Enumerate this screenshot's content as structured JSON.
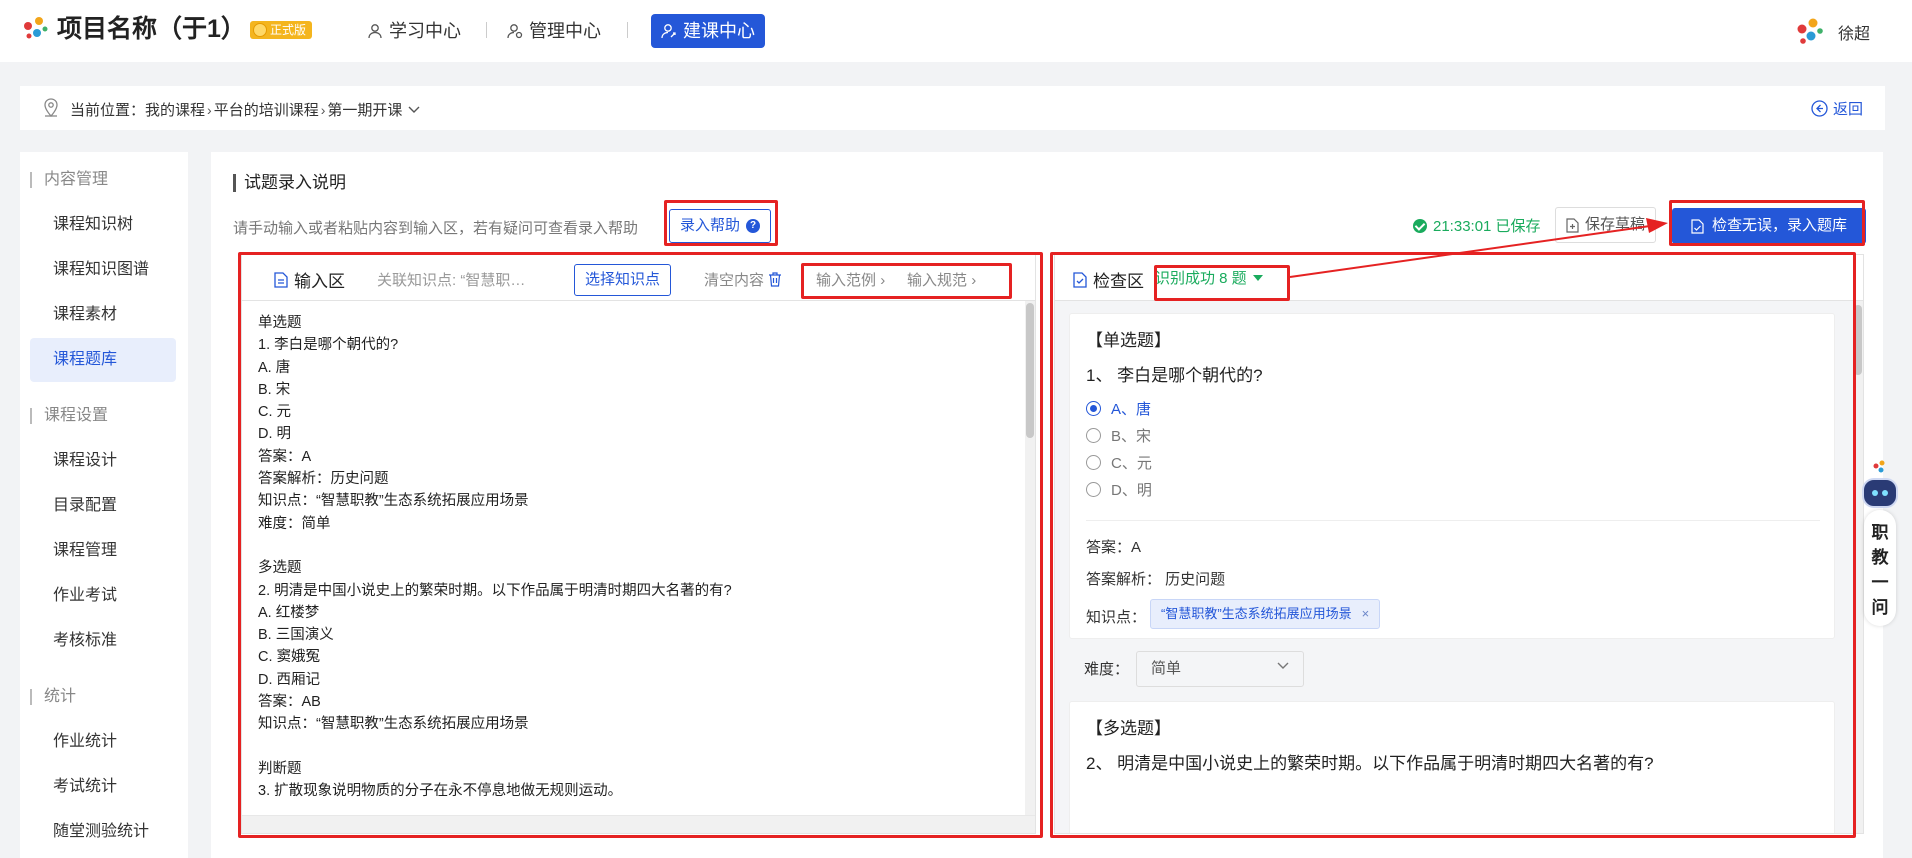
{
  "header": {
    "app_title": "项目名称（于1）",
    "edition": "正式版",
    "nav": [
      {
        "label": "学习中心",
        "icon": "user-study-icon"
      },
      {
        "label": "管理中心",
        "icon": "user-manage-icon"
      },
      {
        "label": "建课中心",
        "icon": "user-build-icon",
        "active": true
      }
    ],
    "user_name": "徐超"
  },
  "breadcrumb": {
    "prefix": "当前位置：",
    "items": [
      "我的课程",
      "平台的培训课程",
      "第一期开课"
    ],
    "back_label": "返回"
  },
  "sidebar": {
    "groups": [
      {
        "title": "内容管理",
        "items": [
          "课程知识树",
          "课程知识图谱",
          "课程素材",
          "课程题库"
        ]
      },
      {
        "title": "课程设置",
        "items": [
          "课程设计",
          "目录配置",
          "课程管理",
          "作业考试",
          "考核标准"
        ]
      },
      {
        "title": "统计",
        "items": [
          "作业统计",
          "考试统计",
          "随堂测验统计"
        ]
      }
    ],
    "active_item": "课程题库"
  },
  "main": {
    "section_title": "试题录入说明",
    "hint": "请手动输入或者粘贴内容到输入区，若有疑问可查看录入帮助",
    "help_label": "录入帮助",
    "saved_status": "21:33:01 已保存",
    "draft_label": "保存草稿",
    "submit_label": "检查无误，录入题库",
    "input_panel": {
      "title": "输入区",
      "knowledge_relation": "关联知识点: “智慧职…",
      "select_kp_label": "选择知识点",
      "clear_label": "清空内容",
      "example_label": "输入范例",
      "spec_label": "输入规范",
      "lines": [
        "单选题",
        "1. 李白是哪个朝代的?",
        "A. 唐",
        "B. 宋",
        "C. 元",
        "D. 明",
        "答案：A",
        "答案解析：历史问题",
        "知识点：“智慧职教”生态系统拓展应用场景",
        "难度：简单",
        "",
        "多选题",
        "2. 明清是中国小说史上的繁荣时期。以下作品属于明清时期四大名著的有?",
        "A. 红楼梦",
        "B. 三国演义",
        "C. 窦娥冤",
        "D. 西厢记",
        "答案：AB",
        "知识点：“智慧职教”生态系统拓展应用场景",
        "",
        "判断题",
        "3. 扩散现象说明物质的分子在永不停息地做无规则运动。"
      ]
    },
    "check_panel": {
      "title": "检查区",
      "recognized": "识别成功 8 题",
      "questions": [
        {
          "type": "【单选题】",
          "stem": "1、 李白是哪个朝代的?",
          "options": [
            "A、唐",
            "B、宋",
            "C、元",
            "D、明"
          ],
          "selected": "A、唐",
          "answer": "答案：A",
          "analysis": "答案解析：  历史问题",
          "kp_label": "知识点：",
          "kp_tag": "“智慧职教”生态系统拓展应用场景",
          "difficulty_label": "难度：",
          "difficulty": "简单"
        },
        {
          "type": "【多选题】",
          "stem": "2、 明清是中国小说史上的繁荣时期。以下作品属于明清时期四大名著的有?"
        }
      ]
    }
  },
  "assistant": {
    "label": "职教一问"
  },
  "colors": {
    "accent": "#2457d8",
    "success": "#1aab5d",
    "annotation": "#e52222"
  }
}
